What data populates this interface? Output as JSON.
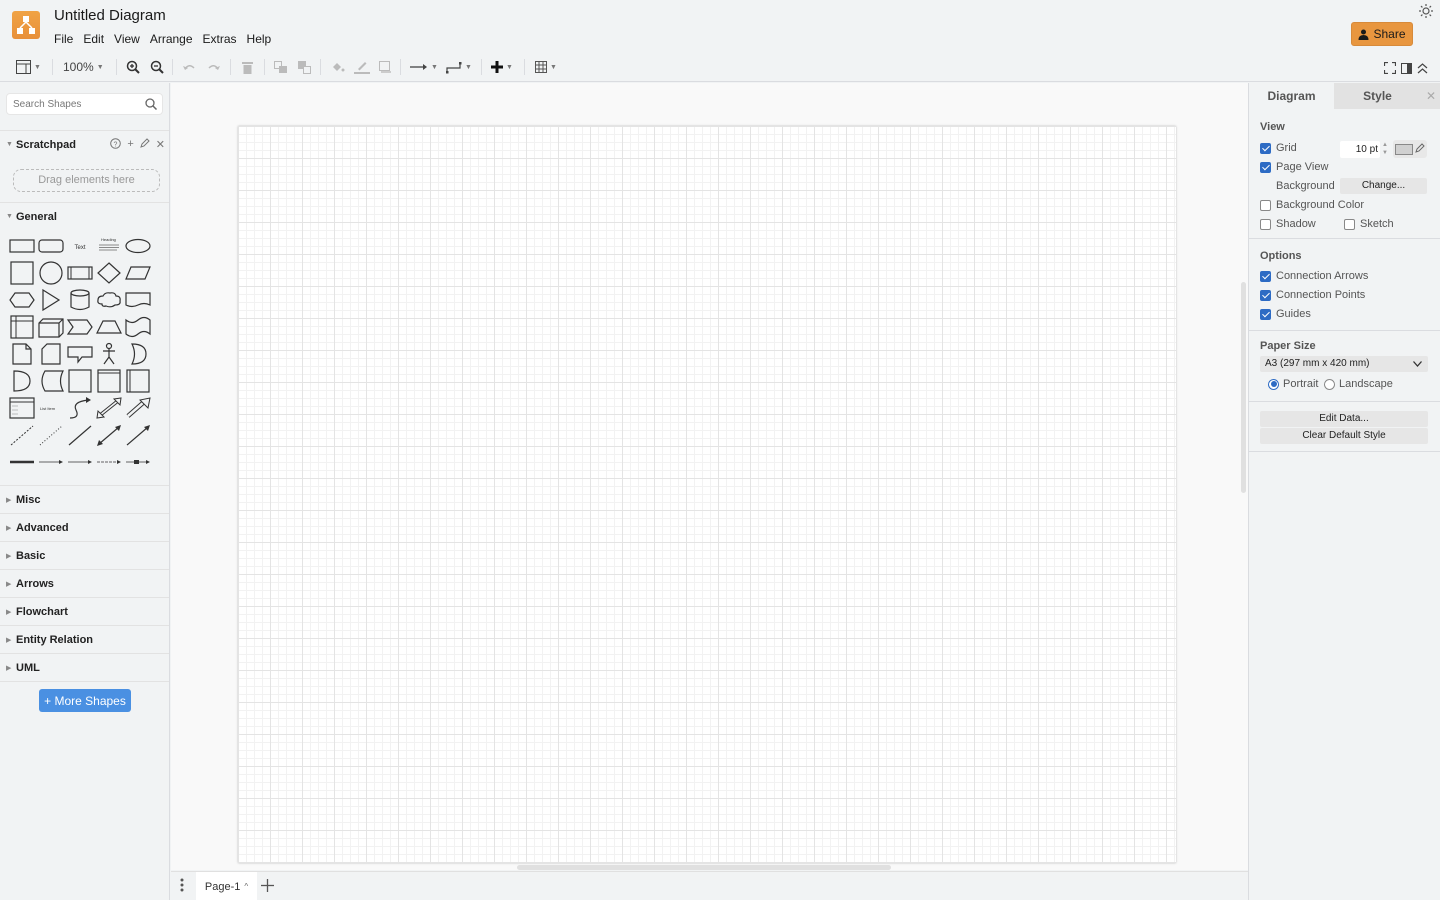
{
  "app": {
    "title": "Untitled Diagram",
    "menu": [
      "File",
      "Edit",
      "View",
      "Arrange",
      "Extras",
      "Help"
    ],
    "share_label": "Share",
    "accent_color": "#e8963f"
  },
  "toolbar": {
    "zoom": "100%",
    "items": [
      "format-panel",
      "zoom-level",
      "zoom-in",
      "zoom-out",
      "undo",
      "redo",
      "delete",
      "to-front",
      "to-back",
      "fill-color",
      "line-color",
      "shadow",
      "connection",
      "waypoints",
      "insert",
      "table"
    ]
  },
  "sidebar": {
    "search_placeholder": "Search Shapes",
    "scratchpad": {
      "label": "Scratchpad",
      "drop_hint": "Drag elements here"
    },
    "general_label": "General",
    "general_shapes": [
      "rectangle",
      "rounded-rectangle",
      "text",
      "textbox",
      "ellipse",
      "square",
      "circle",
      "process",
      "diamond",
      "parallelogram",
      "hexagon",
      "triangle",
      "cylinder",
      "cloud",
      "document",
      "internal-storage",
      "cube",
      "step",
      "trapezoid",
      "tape",
      "note",
      "card",
      "callout",
      "actor",
      "or",
      "and",
      "data-storage",
      "container",
      "vertical-container",
      "horizontal-container",
      "list",
      "list-item",
      "curve",
      "bidirectional-arrow",
      "arrow",
      "dashed-line",
      "dotted-line",
      "line",
      "bidirectional-connector",
      "directional-connector",
      "link",
      "connector-with-label",
      "connector-with-2-labels",
      "connector-with-3-labels",
      "connector-with-symbol"
    ],
    "text_shape_label": "Text",
    "textbox_heading": "Heading",
    "list_item_label": "List Item",
    "sections": [
      "Misc",
      "Advanced",
      "Basic",
      "Arrows",
      "Flowchart",
      "Entity Relation",
      "UML"
    ],
    "more_shapes_label": "+ More Shapes"
  },
  "pages": {
    "current": "Page-1"
  },
  "format_panel": {
    "tabs": [
      "Diagram",
      "Style"
    ],
    "view": {
      "title": "View",
      "grid": {
        "label": "Grid",
        "checked": true,
        "size": "10 pt"
      },
      "page_view": {
        "label": "Page View",
        "checked": true
      },
      "background_label": "Background",
      "change_label": "Change...",
      "background_color": {
        "label": "Background Color",
        "checked": false
      },
      "shadow": {
        "label": "Shadow",
        "checked": false
      },
      "sketch": {
        "label": "Sketch",
        "checked": false
      }
    },
    "options": {
      "title": "Options",
      "connection_arrows": {
        "label": "Connection Arrows",
        "checked": true
      },
      "connection_points": {
        "label": "Connection Points",
        "checked": true
      },
      "guides": {
        "label": "Guides",
        "checked": true
      }
    },
    "paper": {
      "title": "Paper Size",
      "selected": "A3 (297 mm x 420 mm)",
      "portrait_label": "Portrait",
      "landscape_label": "Landscape",
      "orientation": "portrait"
    },
    "edit_data_label": "Edit Data...",
    "clear_style_label": "Clear Default Style"
  }
}
